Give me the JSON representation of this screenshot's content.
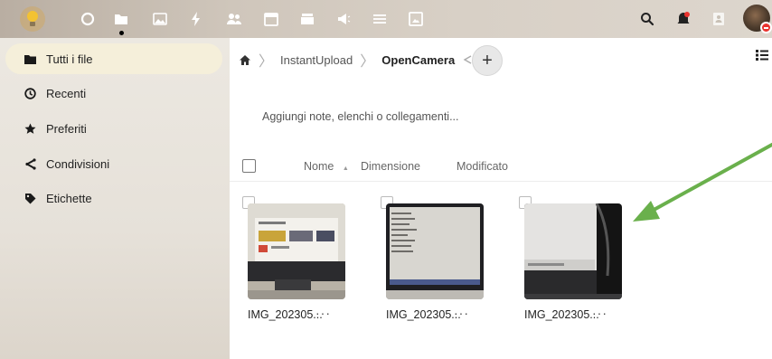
{
  "header": {
    "apps": [
      {
        "name": "dashboard",
        "icon": "circle-outline-icon"
      },
      {
        "name": "files",
        "icon": "folder-icon",
        "active": true
      },
      {
        "name": "photos",
        "icon": "image-icon"
      },
      {
        "name": "activity",
        "icon": "lightning-icon"
      },
      {
        "name": "contacts",
        "icon": "people-icon"
      },
      {
        "name": "calendar",
        "icon": "calendar-icon"
      },
      {
        "name": "deck",
        "icon": "cards-icon"
      },
      {
        "name": "announcements",
        "icon": "megaphone-icon"
      },
      {
        "name": "tasks",
        "icon": "list-icon"
      },
      {
        "name": "gallery",
        "icon": "picture-frame-icon"
      }
    ],
    "right_icons": [
      "search-icon",
      "notification-bell-icon",
      "contacts-menu-icon"
    ],
    "colors": {
      "accent": "#f5efda",
      "status": "#e9322d"
    }
  },
  "sidebar": {
    "items": [
      {
        "label": "Tutti i file",
        "icon": "folder-icon",
        "active": true
      },
      {
        "label": "Recenti",
        "icon": "clock-icon"
      },
      {
        "label": "Preferiti",
        "icon": "star-icon"
      },
      {
        "label": "Condivisioni",
        "icon": "share-icon"
      },
      {
        "label": "Etichette",
        "icon": "tag-icon"
      }
    ]
  },
  "main": {
    "breadcrumb": [
      "InstantUpload",
      "OpenCamera"
    ],
    "notes_placeholder": "Aggiungi note, elenchi o collegamenti...",
    "columns": {
      "name": "Nome",
      "sort_indicator": "▲",
      "size": "Dimensione",
      "modified": "Modificato"
    },
    "files": [
      {
        "name": "IMG_202305...",
        "actions": "···"
      },
      {
        "name": "IMG_202305...",
        "actions": "···"
      },
      {
        "name": "IMG_202305...",
        "actions": "···"
      }
    ],
    "annotation_color": "#6ab04c"
  }
}
